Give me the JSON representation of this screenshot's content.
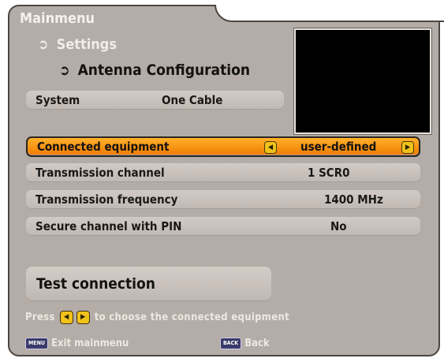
{
  "menu": {
    "title": "Mainmenu",
    "breadcrumb1": "Settings",
    "breadcrumb2": "Antenna Configuration"
  },
  "system_row": {
    "label": "System",
    "value": "One Cable"
  },
  "rows": [
    {
      "label": "Connected equipment",
      "value": "user-defined",
      "selected": true
    },
    {
      "label": "Transmission channel",
      "value": "1 SCR0",
      "selected": false
    },
    {
      "label": "Transmission frequency",
      "value": "1400 MHz",
      "selected": false
    },
    {
      "label": "Secure channel with PIN",
      "value": "No",
      "selected": false
    }
  ],
  "test_button": "Test connection",
  "hint": {
    "prefix": "Press",
    "suffix": "to choose the connected equipment"
  },
  "footer": {
    "menu_key": "MENU",
    "menu_label": "Exit mainmenu",
    "back_key": "BACK",
    "back_label": "Back"
  },
  "icons": {
    "breadcrumb": "arrow-right-icon",
    "left": "left-arrow-icon",
    "right": "right-arrow-icon"
  },
  "colors": {
    "panel": "#b4aca6",
    "selected": "#f59a12",
    "key": "#f1c31a"
  }
}
